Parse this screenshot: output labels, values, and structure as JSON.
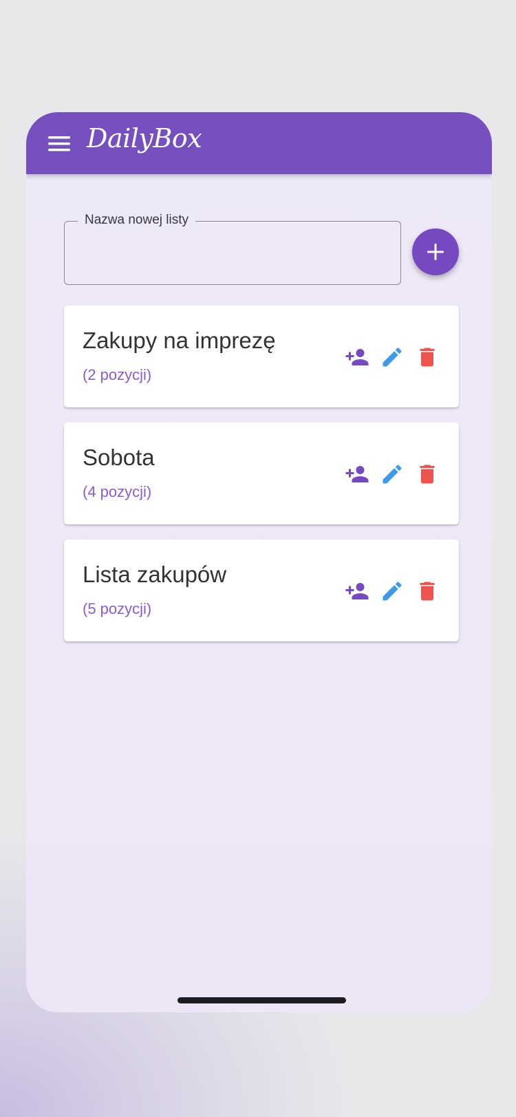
{
  "app": {
    "title": "DailyBox",
    "accent_color": "#7750bf"
  },
  "new_list": {
    "label": "Nazwa nowej listy",
    "value": "",
    "placeholder": "",
    "add_icon": "plus-icon"
  },
  "lists": [
    {
      "title": "Zakupy na imprezę",
      "count_text": "(2 pozycji)"
    },
    {
      "title": "Sobota",
      "count_text": "(4 pozycji)"
    },
    {
      "title": "Lista zakupów",
      "count_text": "(5 pozycji)"
    }
  ],
  "list_actions": {
    "share_icon": "person-add-icon",
    "edit_icon": "pencil-icon",
    "delete_icon": "trash-icon",
    "share_color": "#7649c0",
    "edit_color": "#3d9be9",
    "delete_color": "#ef5350"
  },
  "colors": {
    "background": "#ede6f6",
    "count_text": "#8a5bd6"
  }
}
